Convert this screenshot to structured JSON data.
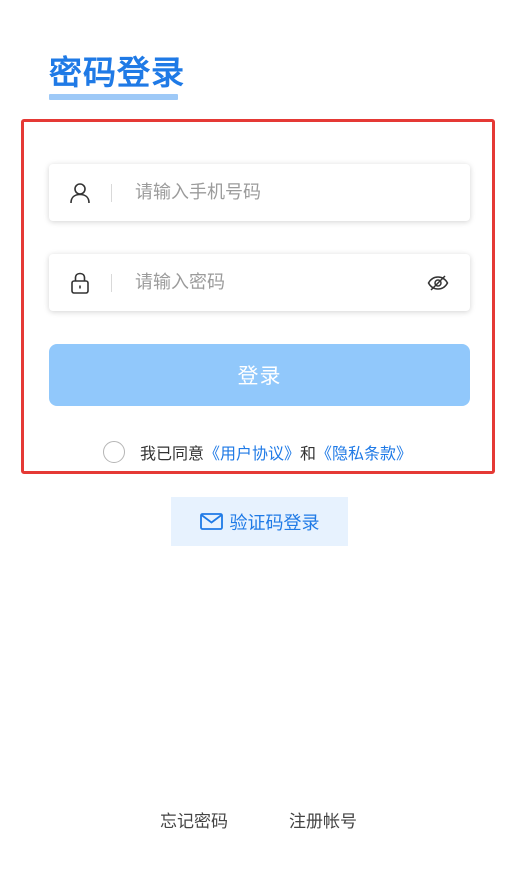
{
  "header": {
    "title": "密码登录"
  },
  "form": {
    "phone": {
      "placeholder": "请输入手机号码",
      "value": "",
      "icon": "user-icon"
    },
    "password": {
      "placeholder": "请输入密码",
      "value": "",
      "icon": "lock-icon",
      "toggle_icon": "eye-hidden-icon"
    },
    "login_label": "登录",
    "agreement": {
      "checked": false,
      "prefix": "我已同意",
      "user_agreement": "《用户协议》",
      "conjunction": "和",
      "privacy_policy": "《隐私条款》"
    }
  },
  "sms_login": {
    "label": "验证码登录",
    "icon": "mail-icon"
  },
  "footer": {
    "forgot_password": "忘记密码",
    "register": "注册帐号"
  },
  "colors": {
    "accent": "#1f7ae6",
    "button_disabled": "#91c8fb",
    "highlight_border": "#e53935",
    "sms_bg": "#e7f2fe"
  }
}
